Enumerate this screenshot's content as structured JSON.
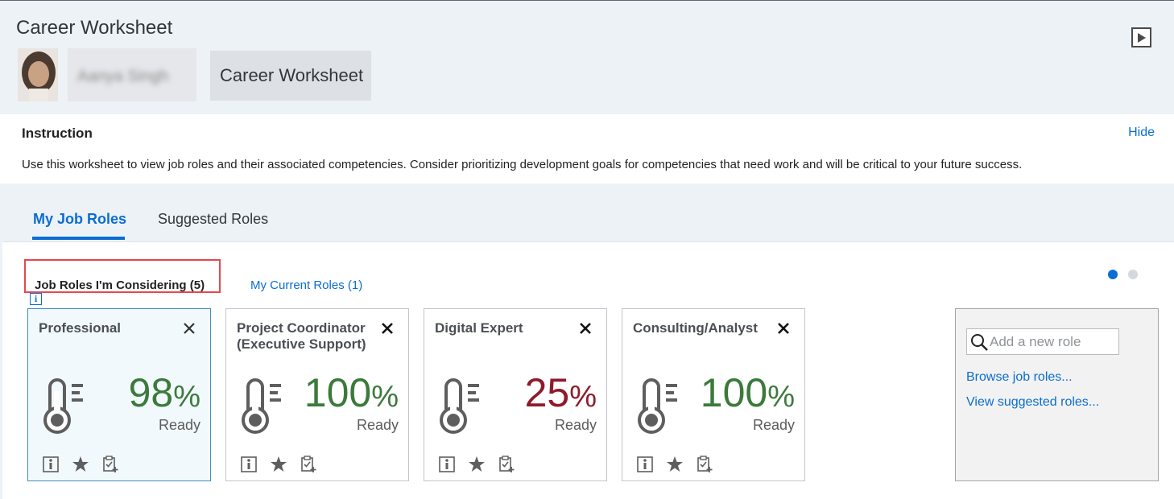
{
  "header": {
    "title": "Career Worksheet",
    "user_name": "Aanya Singh",
    "worksheet_button": "Career Worksheet"
  },
  "instruction": {
    "title": "Instruction",
    "hide_label": "Hide",
    "text": "Use this worksheet to view job roles and their associated competencies. Consider prioritizing development goals for competencies that need work and will be critical to your future success."
  },
  "tabs": {
    "my_job_roles": "My Job Roles",
    "suggested_roles": "Suggested Roles"
  },
  "subtabs": {
    "considering": "Job Roles I'm Considering (5)",
    "current": "My Current Roles (1)"
  },
  "info_glyph": "i",
  "cards": [
    {
      "title": "Professional",
      "value": "98",
      "unit": "%",
      "status": "Ready",
      "color": "#3b7a3b"
    },
    {
      "title": "Project Coordinator (Executive Support)",
      "value": "100",
      "unit": "%",
      "status": "Ready",
      "color": "#3b7a3b"
    },
    {
      "title": "Digital Expert",
      "value": "25",
      "unit": "%",
      "status": "Ready",
      "color": "#8e1b2b"
    },
    {
      "title": "Consulting/Analyst",
      "value": "100",
      "unit": "%",
      "status": "Ready",
      "color": "#3b7a3b"
    }
  ],
  "side_panel": {
    "search_placeholder": "Add a new role",
    "browse_link": "Browse job roles...",
    "suggested_link": "View suggested roles..."
  },
  "pagination": {
    "pages": 2,
    "active_page": 1
  }
}
